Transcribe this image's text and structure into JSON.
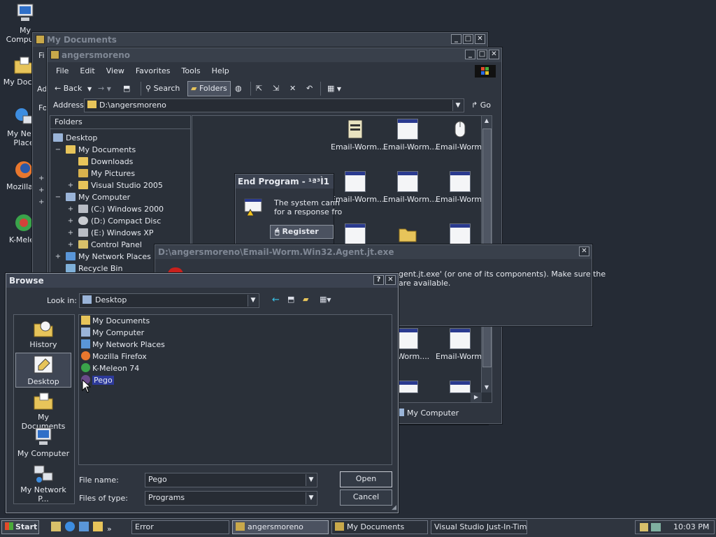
{
  "desktop": {
    "icons": [
      {
        "label": "My Computer",
        "icon": "my-computer-icon"
      },
      {
        "label": "My Docum",
        "icon": "my-documents-icon"
      },
      {
        "label": "My Netw Place",
        "icon": "network-places-icon"
      },
      {
        "label": "Mozilla Fi",
        "icon": "firefox-icon"
      },
      {
        "label": "K-Melec",
        "icon": "k-meleon-icon"
      }
    ]
  },
  "my_documents_window": {
    "title": "My Documents",
    "menu_first": "Fi",
    "address_first": "Ad",
    "folders_first": "Fo"
  },
  "explorer": {
    "title": "angersmoreno",
    "menu": [
      "File",
      "Edit",
      "View",
      "Favorites",
      "Tools",
      "Help"
    ],
    "toolbar": {
      "back": "Back",
      "search": "Search",
      "folders": "Folders"
    },
    "address_label": "Address",
    "address_value": "D:\\angersmoreno",
    "go_label": "Go",
    "folders_pane_title": "Folders",
    "tree": [
      {
        "label": "Desktop",
        "icon": "desktop-icon",
        "expander": ""
      },
      {
        "label": "My Documents",
        "icon": "folder-icon",
        "expander": "−"
      },
      {
        "label": "Downloads",
        "icon": "folder-icon",
        "expander": ""
      },
      {
        "label": "My Pictures",
        "icon": "folder-icon",
        "expander": ""
      },
      {
        "label": "Visual Studio 2005",
        "icon": "folder-icon",
        "expander": "+"
      },
      {
        "label": "My Computer",
        "icon": "computer-icon",
        "expander": "−"
      },
      {
        "label": "(C:) Windows 2000",
        "icon": "drive-icon",
        "expander": "+"
      },
      {
        "label": "(D:) Compact Disc",
        "icon": "cd-icon",
        "expander": "+"
      },
      {
        "label": "(E:) Windows XP",
        "icon": "drive-icon",
        "expander": "+"
      },
      {
        "label": "Control Panel",
        "icon": "control-panel-icon",
        "expander": "+"
      },
      {
        "label": "My Network Places",
        "icon": "network-icon",
        "expander": "+"
      },
      {
        "label": "Recycle Bin",
        "icon": "recycle-bin-icon",
        "expander": ""
      }
    ],
    "files": [
      {
        "label": "Email-Worm....",
        "icon": "notes-icon"
      },
      {
        "label": "Email-Worm....",
        "icon": "window-app-icon"
      },
      {
        "label": "Email-Worm....",
        "icon": "mouse-icon"
      },
      {
        "label": "Email-Worm....",
        "icon": "window-app-icon"
      },
      {
        "label": "Email-Worm....",
        "icon": "window-app-icon"
      },
      {
        "label": "Email-Worm....",
        "icon": "window-app-icon"
      },
      {
        "label": "ail-Worm....",
        "icon": "window-app-icon"
      },
      {
        "label": "Email-Worm....",
        "icon": "window-app-icon"
      }
    ],
    "status_location": "My Computer"
  },
  "end_program": {
    "title": "End Program - ¹ª³Ì1",
    "message_line1": "The system cann",
    "message_line2": "for a response fro",
    "register_label": "Register"
  },
  "error_dialog": {
    "title": "D:\\angersmoreno\\Email-Worm.Win32.Agent.jt.exe",
    "line1": "gent.jt.exe' (or one of its components). Make sure the",
    "line2": "are available."
  },
  "browse": {
    "title": "Browse",
    "look_in_label": "Look in:",
    "look_in_value": "Desktop",
    "places": [
      {
        "label": "History",
        "icon": "history-icon"
      },
      {
        "label": "Desktop",
        "icon": "desktop-icon"
      },
      {
        "label": "My Documents",
        "icon": "my-documents-icon"
      },
      {
        "label": "My Computer",
        "icon": "my-computer-icon"
      },
      {
        "label": "My Network P...",
        "icon": "network-places-icon"
      }
    ],
    "items": [
      {
        "label": "My Documents",
        "icon": "folder-icon"
      },
      {
        "label": "My Computer",
        "icon": "computer-icon"
      },
      {
        "label": "My Network Places",
        "icon": "network-icon"
      },
      {
        "label": "Mozilla Firefox",
        "icon": "firefox-icon"
      },
      {
        "label": "K-Meleon 74",
        "icon": "k-meleon-icon"
      },
      {
        "label": "Pego",
        "icon": "pego-icon"
      }
    ],
    "file_name_label": "File name:",
    "file_name_value": "Pego",
    "file_type_label": "Files of type:",
    "file_type_value": "Programs",
    "open_label": "Open",
    "cancel_label": "Cancel"
  },
  "taskbar": {
    "start_label": "Start",
    "tasks": [
      "Error",
      "angersmoreno",
      "My Documents",
      "Visual Studio Just-In-Tim..."
    ],
    "clock": "10:03 PM"
  }
}
